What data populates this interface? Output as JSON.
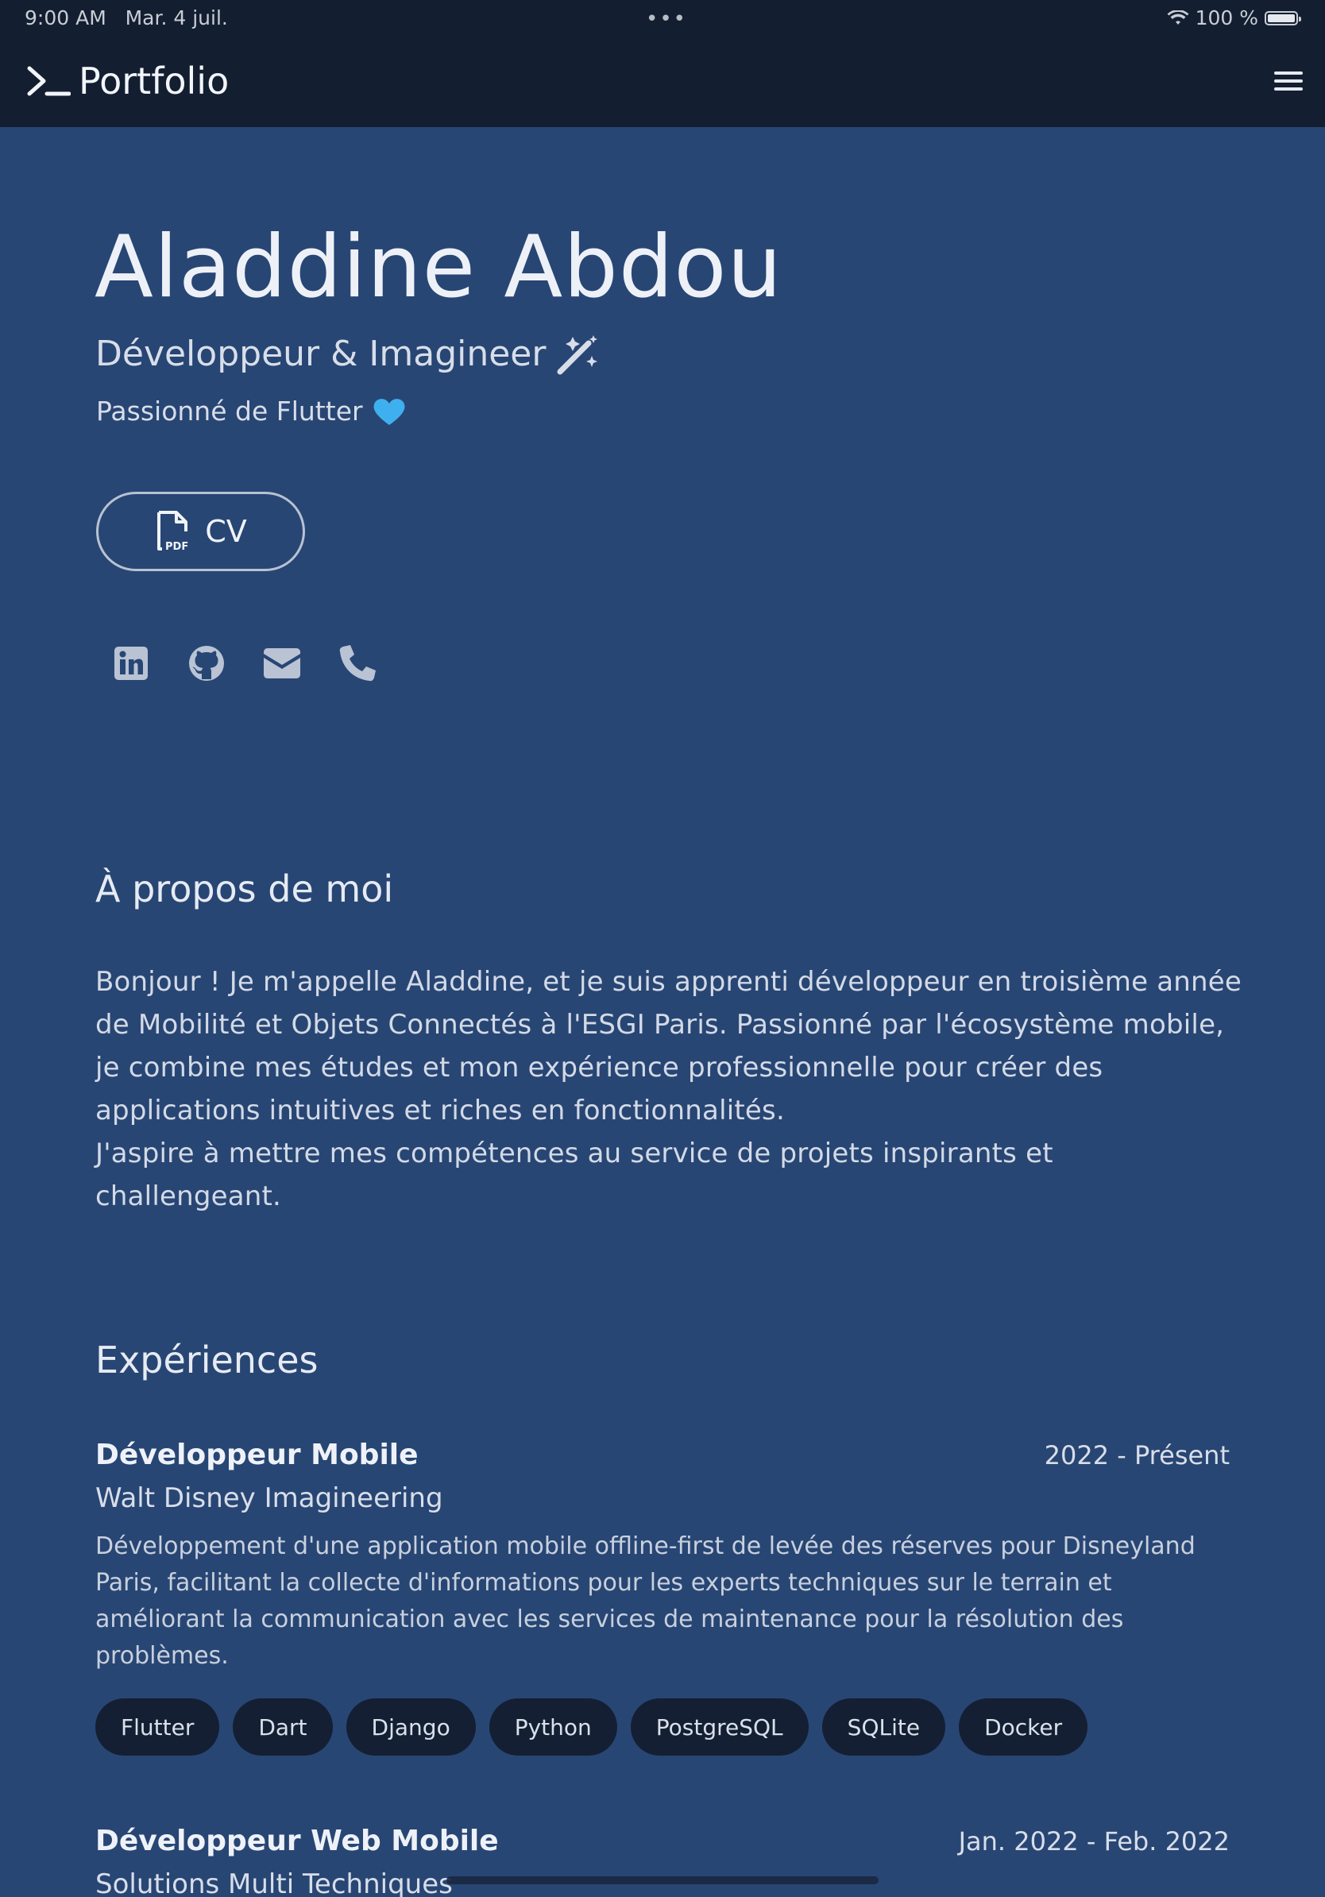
{
  "status_bar": {
    "time": "9:00 AM",
    "date": "Mar. 4 juil.",
    "multitask_dots": "•••",
    "battery": "100 %"
  },
  "app_bar": {
    "brand_icon": "terminal-prompt-icon",
    "title": "Portfolio",
    "menu_icon": "hamburger-menu-icon"
  },
  "hero": {
    "name": "Aladdine Abdou",
    "role": "Développeur & Imagineer",
    "role_icon": "magic-wand-icon",
    "tagline": "Passionné de Flutter",
    "tagline_icon": "blue-heart-icon",
    "cv_button": {
      "label": "CV",
      "icon": "pdf-file-icon"
    },
    "socials": [
      {
        "name": "linkedin-icon"
      },
      {
        "name": "github-icon"
      },
      {
        "name": "email-icon"
      },
      {
        "name": "phone-icon"
      }
    ]
  },
  "about": {
    "title": "À propos de moi",
    "paragraph_1": "Bonjour ! Je m'appelle Aladdine, et je suis apprenti développeur en troisième année de Mobilité et Objets Connectés à l'ESGI Paris. Passionné par l'écosystème mobile, je combine mes études et mon expérience professionnelle pour créer des applications intuitives et riches en fonctionnalités.",
    "paragraph_2": "J'aspire à mettre mes compétences au service de projets inspirants et challengeant."
  },
  "experiences": {
    "title": "Expériences",
    "items": [
      {
        "role": "Développeur Mobile",
        "dates": "2022 - Présent",
        "company": "Walt Disney Imagineering",
        "description": "Développement d'une application mobile offline-first de levée des réserves pour Disneyland Paris, facilitant la collecte d'informations pour les experts techniques sur le terrain et améliorant la communication avec les services de maintenance pour la résolution des problèmes.",
        "tags": [
          "Flutter",
          "Dart",
          "Django",
          "Python",
          "PostgreSQL",
          "SQLite",
          "Docker"
        ]
      },
      {
        "role": "Développeur Web Mobile",
        "dates": "Jan. 2022 - Feb. 2022",
        "company": "Solutions Multi Techniques"
      }
    ]
  },
  "colors": {
    "background": "#284674",
    "app_bar": "#131e30",
    "tag_background": "#141f33",
    "text_primary": "#edf1f7"
  }
}
